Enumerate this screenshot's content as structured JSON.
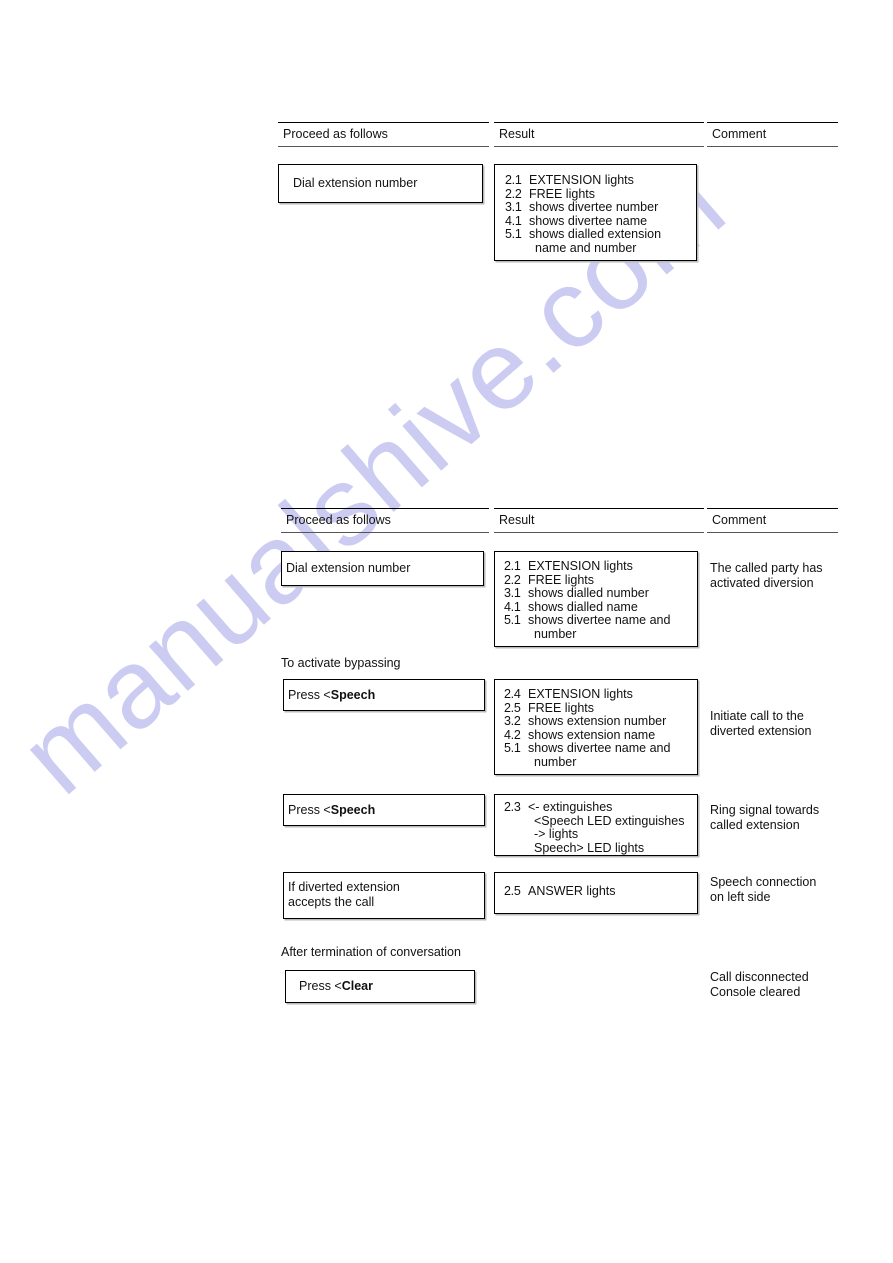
{
  "watermark": {
    "text": "manualshive.com",
    "color": "#ccccf2"
  },
  "tables": [
    {
      "id": "table-1",
      "headers": {
        "proceed": "Proceed as follows",
        "result": "Result",
        "comment": "Comment"
      },
      "rows": [
        {
          "id": "row-1-1",
          "action": "Dial extension number",
          "action_prefix": "",
          "action_bold": "",
          "result": [
            {
              "code": "2.1",
              "text": "EXTENSION lights"
            },
            {
              "code": "2.2",
              "text": "FREE lights"
            },
            {
              "code": "3.1",
              "text": "shows divertee number"
            },
            {
              "code": "4.1",
              "text": "shows divertee name"
            },
            {
              "code": "5.1",
              "text": "shows dialled extension"
            },
            {
              "code": "",
              "text": "name and number"
            }
          ],
          "comment": ""
        }
      ]
    },
    {
      "id": "table-2",
      "headers": {
        "proceed": "Proceed as follows",
        "result": "Result",
        "comment": "Comment"
      },
      "captions": {
        "activate_bypassing": "To activate bypassing",
        "after_termination": "After termination of conversation"
      },
      "rows": [
        {
          "id": "row-2-1",
          "action": "Dial extension number",
          "action_prefix": "",
          "action_bold": "",
          "result": [
            {
              "code": "2.1",
              "text": "EXTENSION lights"
            },
            {
              "code": "2.2",
              "text": "FREE lights"
            },
            {
              "code": "3.1",
              "text": "shows dialled number"
            },
            {
              "code": "4.1",
              "text": "shows dialled name"
            },
            {
              "code": "5.1",
              "text": "shows divertee name and"
            },
            {
              "code": "",
              "text": "number"
            }
          ],
          "comment": "The called party has\nactivated diversion"
        },
        {
          "id": "row-2-2",
          "action": "",
          "action_prefix": "Press <",
          "action_bold": "Speech",
          "result": [
            {
              "code": "2.4",
              "text": "EXTENSION lights"
            },
            {
              "code": "2.5",
              "text": "FREE lights"
            },
            {
              "code": "3.2",
              "text": "shows extension number"
            },
            {
              "code": "4.2",
              "text": "shows extension name"
            },
            {
              "code": "5.1",
              "text": "shows divertee name and"
            },
            {
              "code": "",
              "text": "number"
            }
          ],
          "comment": "Initiate call to the\ndiverted extension"
        },
        {
          "id": "row-2-3",
          "action": "",
          "action_prefix": "Press <",
          "action_bold": "Speech",
          "result": [
            {
              "code": "2.3",
              "text": "<- extinguishes"
            },
            {
              "code": "",
              "text": "<Speech LED extinguishes"
            },
            {
              "code": "",
              "text": "-> lights"
            },
            {
              "code": "",
              "text": "Speech> LED lights"
            }
          ],
          "comment": "Ring signal towards\ncalled extension"
        },
        {
          "id": "row-2-4",
          "action": "If diverted extension\naccepts the call",
          "action_prefix": "",
          "action_bold": "",
          "result": [
            {
              "code": "2.5",
              "text": "ANSWER lights"
            }
          ],
          "comment": "Speech connection\non left side"
        },
        {
          "id": "row-2-5",
          "action": "",
          "action_prefix": "Press <",
          "action_bold": "Clear",
          "result": [],
          "comment": "Call disconnected\nConsole cleared"
        }
      ]
    }
  ]
}
